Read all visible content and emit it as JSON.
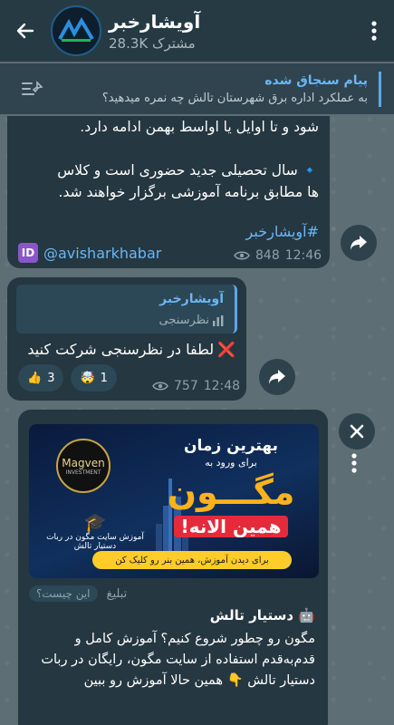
{
  "header": {
    "title": "آویشارخبر",
    "subtitle": "28.3K مشترک"
  },
  "pinned": {
    "title": "پیام سنجاق شده",
    "text": "به عملکرد اداره برق شهرستان تالش چه نمره میدهید؟"
  },
  "msg1": {
    "line1": "شود و تا اوایل یا اواسط بهمن ادامه دارد.",
    "line2": "سال تحصیلی جدید حضوری است و کلاس",
    "line3": "ها مطابق برنامه آموزشی برگزار خواهند شد.",
    "hashtag": "#آویشارخبر",
    "id_badge": "ID",
    "link": "@avisharkhabar",
    "views": "848",
    "time": "12:46"
  },
  "msg2": {
    "reply_name": "آویشارخبر",
    "reply_sub": "نظرسنجی",
    "text": "لطفا در نظرسنجی شرکت کنید",
    "reactions": [
      {
        "emoji": "👍",
        "count": "3"
      },
      {
        "emoji": "🤯",
        "count": "1"
      }
    ],
    "views": "757",
    "time": "12:48"
  },
  "msg3": {
    "banner_line1": "بهترین زمان",
    "banner_line2": "برای ورود به",
    "banner_brand": "مگـــون",
    "banner_now": "همین الانه!",
    "banner_cta": "برای دیدن آموزش، همین بنر رو کلیک کن",
    "logo_name": "Magven",
    "logo_sub": "INVESTMENT",
    "edu_text": "آموزش سایت مگون در ربات دستیار تالش",
    "ad_label": "تبلیغ",
    "ad_what": "این چیست؟",
    "ad_name": "دستیار تالش",
    "ad_body": "مگون رو چطور شروع کنیم؟ آموزش کامل و قدم‌به‌قدم استفاده از سایت مگون، رایگان در ربات دستیار تالش 👇 همین حالا آموزش رو ببین"
  }
}
